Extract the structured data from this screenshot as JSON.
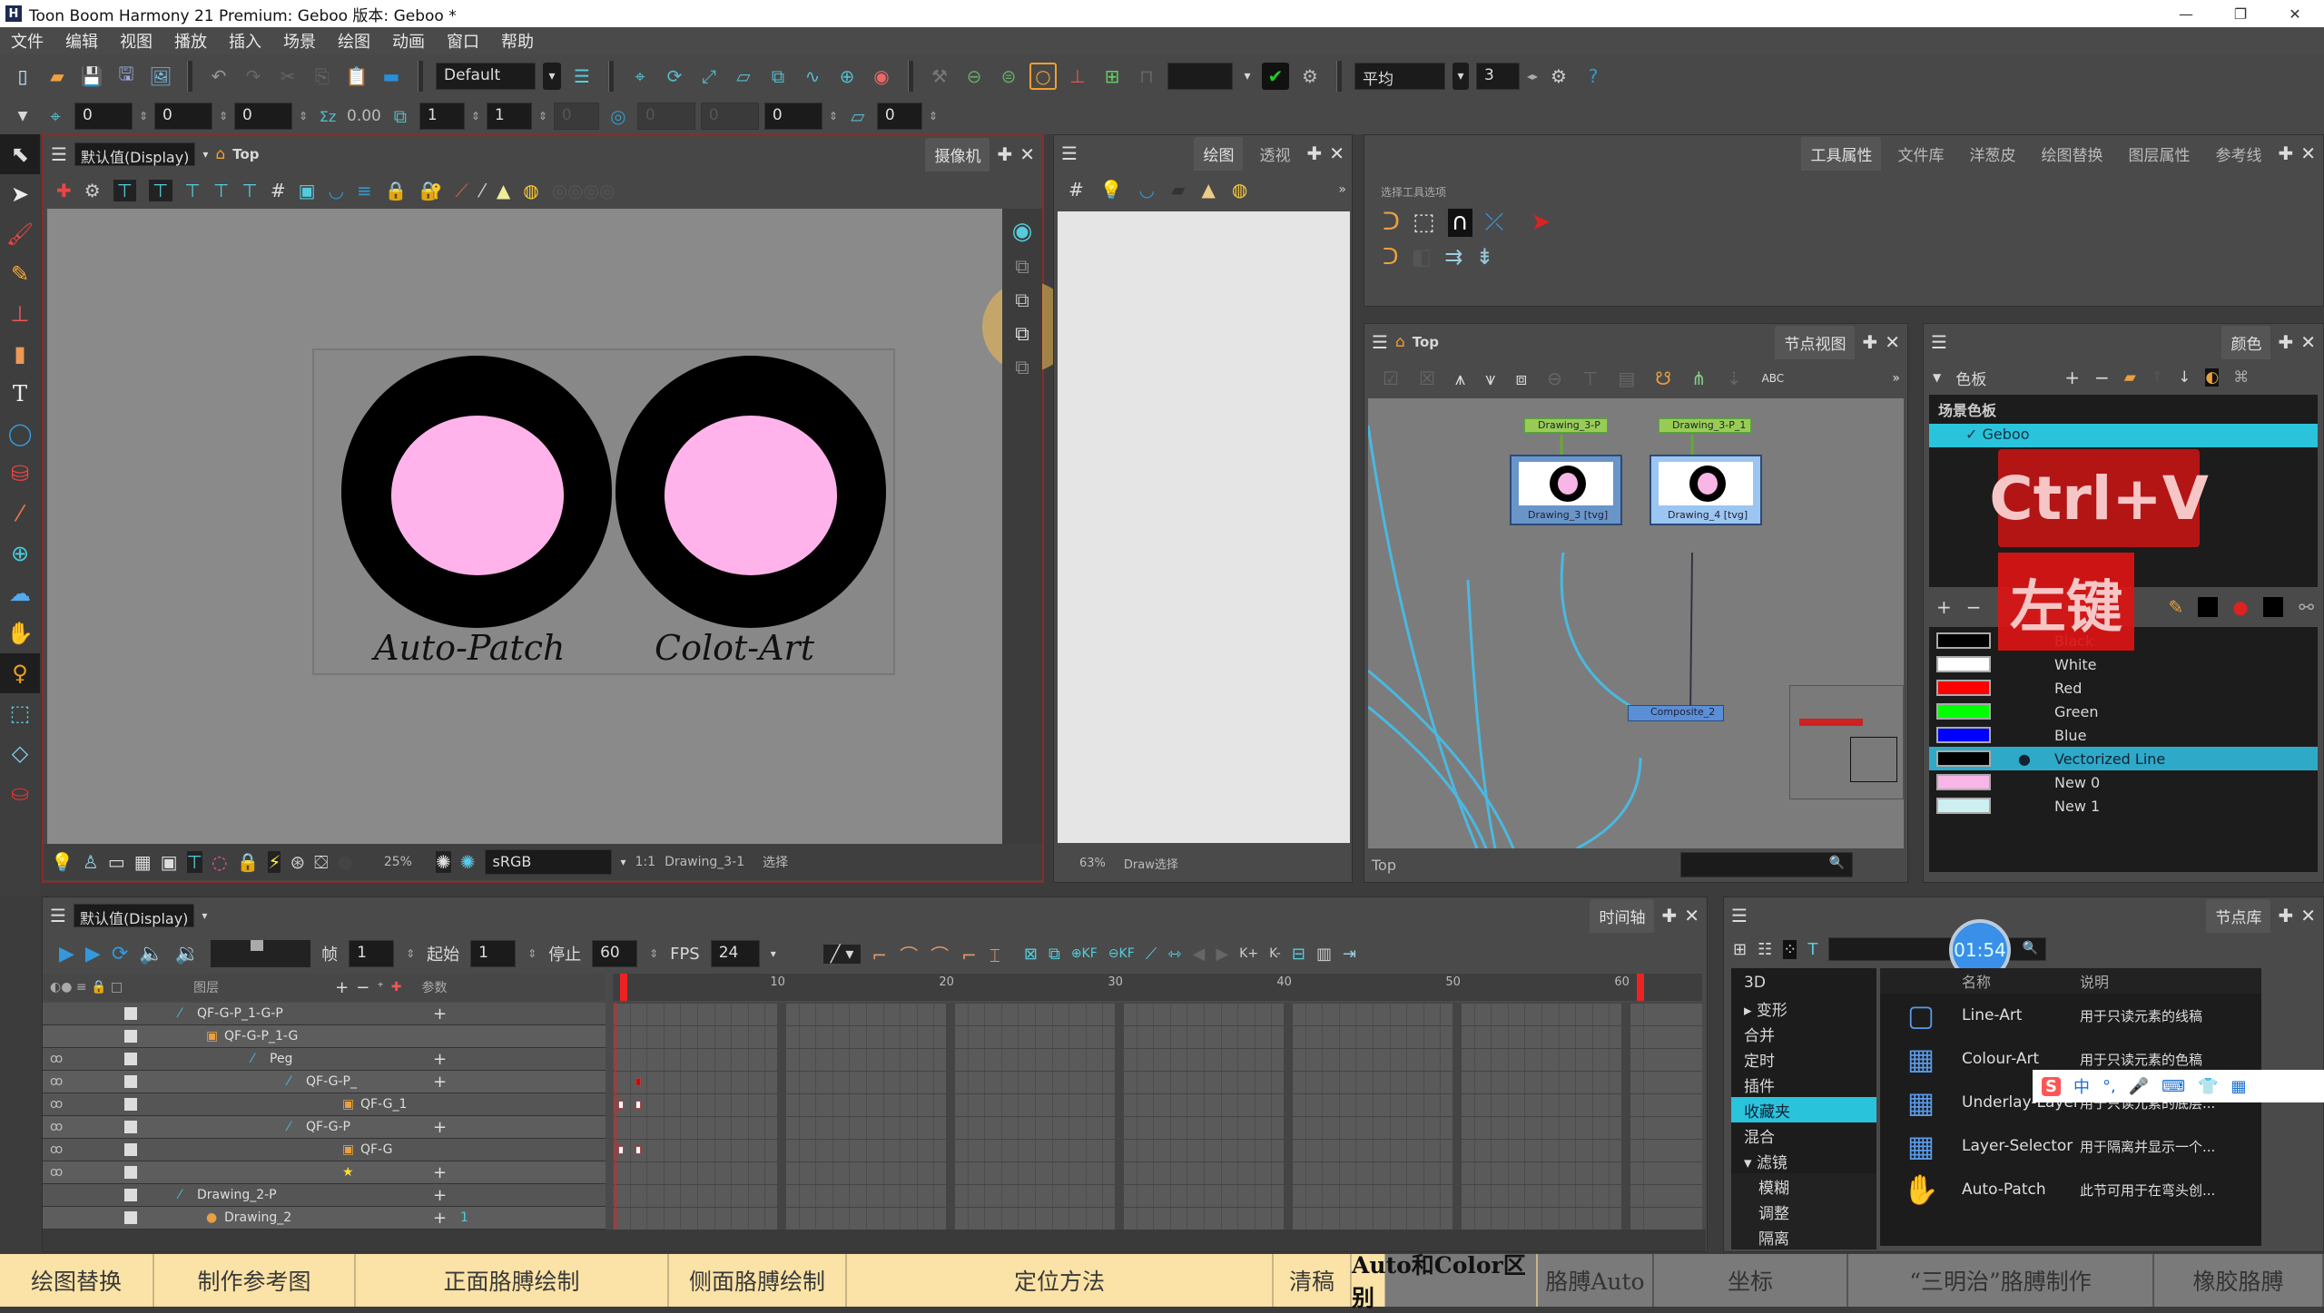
{
  "window": {
    "title": "Toon Boom Harmony 21 Premium: Geboo 版本: Geboo *",
    "logo": "H",
    "minimize": "—",
    "restore": "❐",
    "close": "✕"
  },
  "menu": [
    "文件",
    "编辑",
    "视图",
    "播放",
    "插入",
    "场景",
    "绘图",
    "动画",
    "窗口",
    "帮助"
  ],
  "toolbar1": {
    "workspace": "Default",
    "smoothing_mode": "平均",
    "smoothing_value": "3"
  },
  "toolbar2": {
    "x": "0",
    "y": "0",
    "z": "0",
    "angle": "0.00",
    "scale_x": "1",
    "scale_y": "1",
    "skew": "0",
    "r1": "0",
    "r2": "0",
    "r3": "0",
    "r4": "0"
  },
  "camera_view": {
    "display": "默认值(Display)",
    "breadcrumb": "Top",
    "tab": "摄像机",
    "stage_labels": [
      "Auto-Patch",
      "Color-Art"
    ],
    "stage_labels_as_drawn": [
      "Auto-Patch",
      "Colot-Art"
    ],
    "zoom": "25%",
    "color_space": "sRGB",
    "ratio": "1:1",
    "drawing": "Drawing_3-1",
    "tool": "选择",
    "colors": {
      "line": "#000000",
      "fill": "#ffb3ea",
      "frame_border": "#8a2b2b"
    }
  },
  "drawing_view": {
    "tabs": [
      "绘图",
      "透视"
    ],
    "zoom": "63%",
    "drawing": "Draw选择"
  },
  "tool_properties": {
    "tabs": [
      "工具属性",
      "文件库",
      "洋葱皮",
      "绘图替换",
      "图层属性",
      "参考线"
    ],
    "section": "选择工具选项"
  },
  "node_view": {
    "breadcrumb": "Top",
    "tab": "节点视图",
    "footer": "Top",
    "nodes": {
      "peg1": "Drawing_3-P",
      "peg2": "Drawing_3-P_1",
      "draw1": "Drawing_3 [tvg]",
      "draw2": "Drawing_4 [tvg]",
      "composite": "Composite_2"
    }
  },
  "color_panel": {
    "tab": "颜色",
    "palette_header": "色板",
    "scene_palette": "场景色板",
    "palette": "Geboo",
    "overlay_hotkey": "Ctrl+V",
    "overlay_click": "左键",
    "swatches": [
      {
        "name": "Black",
        "color": "#000000"
      },
      {
        "name": "White",
        "color": "#ffffff"
      },
      {
        "name": "Red",
        "color": "#ff0000"
      },
      {
        "name": "Green",
        "color": "#00ff00"
      },
      {
        "name": "Blue",
        "color": "#0000ff"
      },
      {
        "name": "Vectorized Line",
        "color": "#000000",
        "selected": true
      },
      {
        "name": "New 0",
        "color": "#f7b6e6"
      },
      {
        "name": "New 1",
        "color": "#cdeff0"
      }
    ]
  },
  "timeline": {
    "display": "默认值(Display)",
    "tab": "时间轴",
    "frame_label": "帧",
    "frame": "1",
    "start_label": "起始",
    "start": "1",
    "stop_label": "停止",
    "stop": "60",
    "fps_label": "FPS",
    "fps": "24",
    "layers_header": "图层",
    "params_header": "参数",
    "ruler": [
      "10",
      "20",
      "30",
      "40",
      "50",
      "60"
    ],
    "layers": [
      {
        "name": "QF-G-P_1-G-P",
        "type": "peg"
      },
      {
        "name": "QF-G-P_1-G",
        "type": "group"
      },
      {
        "name": "Peg",
        "type": "peg"
      },
      {
        "name": "QF-G-P_",
        "type": "peg"
      },
      {
        "name": "QF-G_1",
        "type": "group"
      },
      {
        "name": "QF-G-P",
        "type": "peg"
      },
      {
        "name": "QF-G",
        "type": "group"
      },
      {
        "name": "",
        "type": "star"
      },
      {
        "name": "Drawing_2-P",
        "type": "peg"
      },
      {
        "name": "Drawing_2",
        "type": "drawing",
        "param": "1"
      }
    ]
  },
  "library": {
    "tab": "节点库",
    "timer": "01:54",
    "col_name": "名称",
    "col_desc": "说明",
    "categories": [
      "3D",
      "变形",
      "合并",
      "定时",
      "插件",
      "收藏夹",
      "混合",
      "滤镜",
      "模糊",
      "调整",
      "隔离"
    ],
    "selected_category": "收藏夹",
    "items": [
      {
        "name": "Line-Art",
        "desc": "用于只读元素的线稿"
      },
      {
        "name": "Colour-Art",
        "desc": "用于只读元素的色稿"
      },
      {
        "name": "Underlay-Layer",
        "desc": "用于只读元素的底层..."
      },
      {
        "name": "Layer-Selector",
        "desc": "用于隔离并显示一个..."
      },
      {
        "name": "Auto-Patch",
        "desc": "此节可用于在弯头创..."
      }
    ],
    "ime": [
      "中",
      "°,",
      "🎤",
      "⌨",
      "👕",
      "▦"
    ]
  },
  "chapters": [
    {
      "label": "绘图替换",
      "state": "done"
    },
    {
      "label": "制作参考图",
      "state": "done"
    },
    {
      "label": "正面胳膊绘制",
      "state": "done"
    },
    {
      "label": "侧面胳膊绘制",
      "state": "done"
    },
    {
      "label": "定位方法",
      "state": "done"
    },
    {
      "label": "清稿",
      "state": "done"
    },
    {
      "label": "Auto和Color区别",
      "state": "current"
    },
    {
      "label": "胳膊Auto",
      "state": "todo"
    },
    {
      "label": "坐标",
      "state": "todo"
    },
    {
      "label": "“三明治”胳膊制作",
      "state": "todo"
    },
    {
      "label": "橡胶胳膊",
      "state": "todo"
    }
  ]
}
